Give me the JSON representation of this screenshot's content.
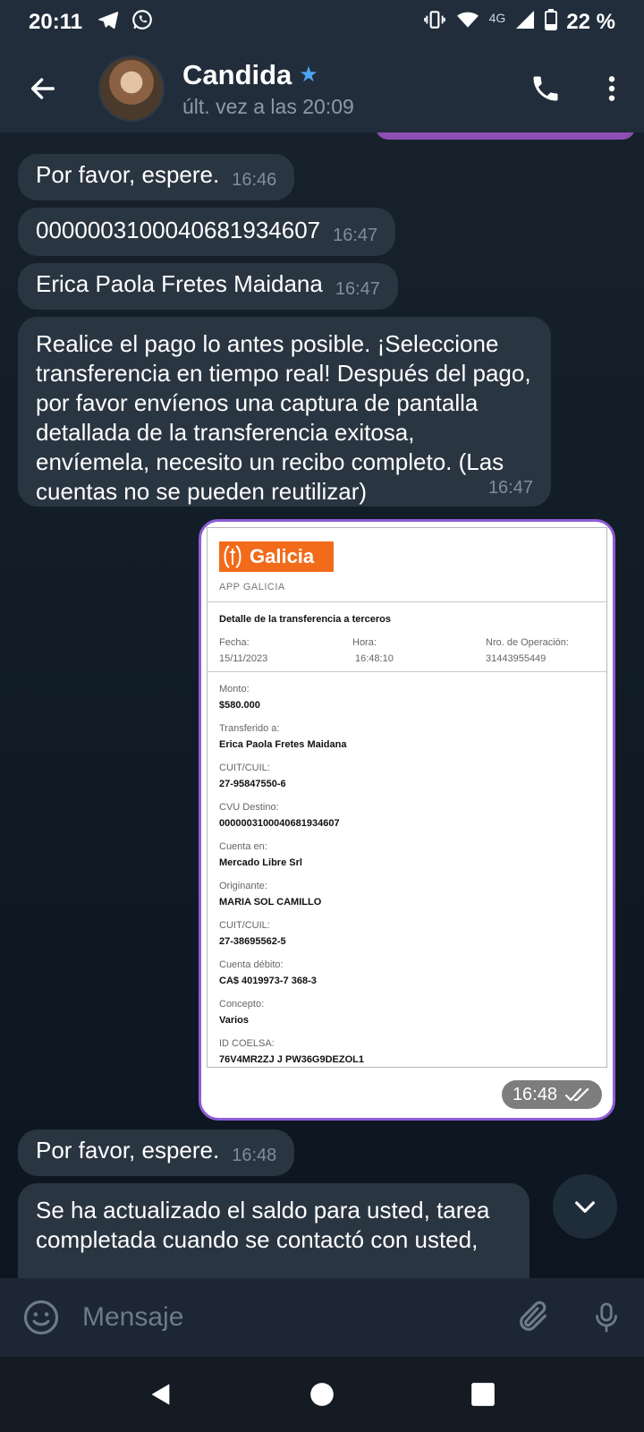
{
  "status_bar": {
    "time": "20:11",
    "network": "4G",
    "battery": "22 %",
    "icons": [
      "telegram-icon",
      "whatsapp-icon",
      "vibrate-icon",
      "wifi-icon",
      "signal-icon",
      "battery-icon"
    ]
  },
  "header": {
    "contact_name": "Candida",
    "last_seen": "últ. vez a las 20:09",
    "icons": [
      "back-arrow-icon",
      "star-icon",
      "phone-icon",
      "more-vert-icon"
    ]
  },
  "messages": [
    {
      "text": "Por favor, espere.",
      "time": "16:46"
    },
    {
      "text": "0000003100040681934607",
      "time": "16:47"
    },
    {
      "text": "Erica Paola Fretes Maidana",
      "time": "16:47"
    },
    {
      "text": "Realice el pago lo antes posible. ¡Seleccione transferencia en tiempo real! Después del pago, por favor envíenos una captura de pantalla detallada de la transferencia exitosa, envíemela, necesito un recibo completo. (Las cuentas no se pueden reutilizar)",
      "time": "16:47"
    },
    {
      "text": "Por favor, espere.",
      "time": "16:48"
    },
    {
      "text": "Se ha actualizado el saldo para usted, tarea completada cuando se contactó con usted,"
    }
  ],
  "image_message": {
    "time": "16:48",
    "status_icon": "double-check-icon",
    "receipt": {
      "brand": "Galicia",
      "app_label": "APP GALICIA",
      "title": "Detalle de la transferencia a terceros",
      "fecha_label": "Fecha:",
      "fecha": "15/11/2023",
      "hora_label": "Hora:",
      "hora": "16:48:10",
      "operacion_label": "Nro. de Operación:",
      "operacion": "31443955449",
      "fields": [
        {
          "label": "Monto:",
          "value": "$580.000"
        },
        {
          "label": "Transferido a:",
          "value": "Erica Paola Fretes Maidana"
        },
        {
          "label": "CUIT/CUIL:",
          "value": "27-95847550-6"
        },
        {
          "label": "CVU Destino:",
          "value": "0000003100040681934607"
        },
        {
          "label": "Cuenta en:",
          "value": "Mercado Libre Srl"
        },
        {
          "label": "Originante:",
          "value": "MARIA SOL CAMILLO"
        },
        {
          "label": "CUIT/CUIL:",
          "value": "27-38695562-5"
        },
        {
          "label": "Cuenta débito:",
          "value": "CA$ 4019973-7 368-3"
        },
        {
          "label": "Concepto:",
          "value": "Varios"
        },
        {
          "label": "ID COELSA:",
          "value": "76V4MR2ZJ J PW36G9DEZOL1"
        }
      ]
    }
  },
  "input": {
    "placeholder": "Mensaje"
  },
  "colors": {
    "header_bg": "#212d3b",
    "chat_bg": "#17212b",
    "bubble_bg": "#2a3542",
    "accent_star": "#4ea4f6",
    "image_border": "#8e5dd6",
    "galicia_orange": "#f26b1a"
  }
}
